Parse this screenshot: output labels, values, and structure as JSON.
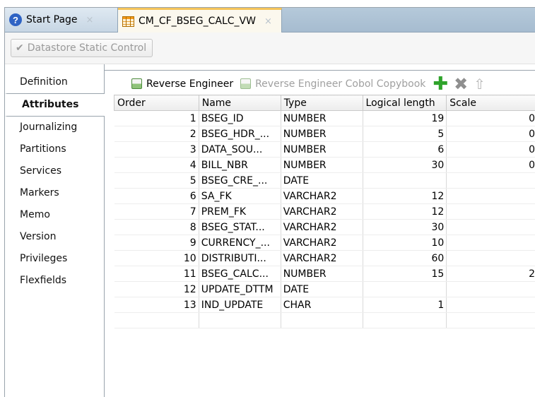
{
  "tabs": [
    {
      "label": "Start Page",
      "close": "×",
      "icon": "help-icon"
    },
    {
      "label": "CM_CF_BSEG_CALC_VW",
      "close": "×",
      "icon": "table-icon"
    }
  ],
  "toolbar": {
    "datastore_button": "Datastore Static Control"
  },
  "nav": {
    "items": [
      "Definition",
      "Attributes",
      "Journalizing",
      "Partitions",
      "Services",
      "Markers",
      "Memo",
      "Version",
      "Privileges",
      "Flexfields"
    ],
    "selected": "Attributes"
  },
  "actions": {
    "reverse_engineer": "Reverse Engineer",
    "reverse_engineer_cobol": "Reverse Engineer Cobol Copybook"
  },
  "grid": {
    "columns": [
      "Order",
      "Name",
      "Type",
      "Logical length",
      "Scale"
    ],
    "rows": [
      {
        "order": "1",
        "name": "BSEG_ID",
        "type": "NUMBER",
        "length": "19",
        "scale": "0"
      },
      {
        "order": "2",
        "name": "BSEG_HDR_...",
        "type": "NUMBER",
        "length": "5",
        "scale": "0"
      },
      {
        "order": "3",
        "name": "DATA_SOU...",
        "type": "NUMBER",
        "length": "6",
        "scale": "0"
      },
      {
        "order": "4",
        "name": "BILL_NBR",
        "type": "NUMBER",
        "length": "30",
        "scale": "0"
      },
      {
        "order": "5",
        "name": "BSEG_CRE_...",
        "type": "DATE",
        "length": "",
        "scale": ""
      },
      {
        "order": "6",
        "name": "SA_FK",
        "type": "VARCHAR2",
        "length": "12",
        "scale": ""
      },
      {
        "order": "7",
        "name": "PREM_FK",
        "type": "VARCHAR2",
        "length": "12",
        "scale": ""
      },
      {
        "order": "8",
        "name": "BSEG_STAT...",
        "type": "VARCHAR2",
        "length": "30",
        "scale": ""
      },
      {
        "order": "9",
        "name": "CURRENCY_...",
        "type": "VARCHAR2",
        "length": "10",
        "scale": ""
      },
      {
        "order": "10",
        "name": "DISTRIBUTI...",
        "type": "VARCHAR2",
        "length": "60",
        "scale": ""
      },
      {
        "order": "11",
        "name": "BSEG_CALC...",
        "type": "NUMBER",
        "length": "15",
        "scale": "2"
      },
      {
        "order": "12",
        "name": "UPDATE_DTTM",
        "type": "DATE",
        "length": "",
        "scale": ""
      },
      {
        "order": "13",
        "name": "IND_UPDATE",
        "type": "CHAR",
        "length": "1",
        "scale": ""
      }
    ]
  }
}
